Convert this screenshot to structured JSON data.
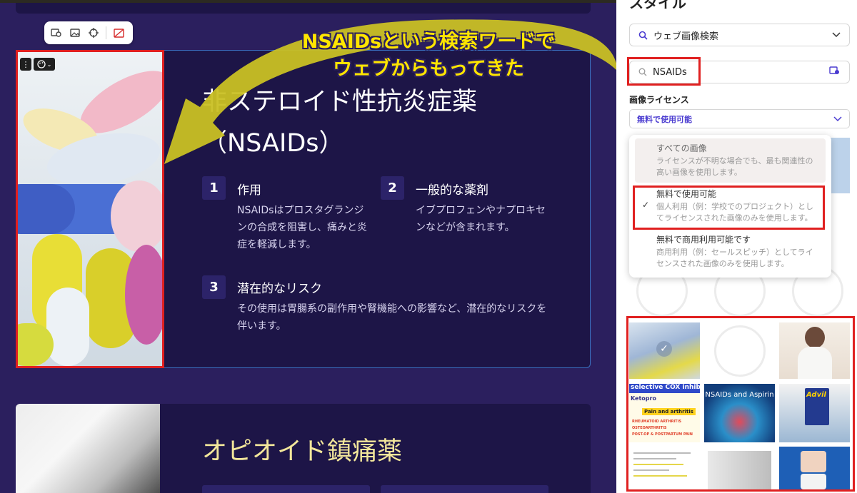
{
  "slide": {
    "heading1_line1": "非ステロイド性抗炎症薬",
    "heading1_line2": "（NSAIDs）",
    "items": [
      {
        "num": "1",
        "title": "作用",
        "body": "NSAIDsはプロスタグランジンの合成を阻害し、痛みと炎症を軽減します。"
      },
      {
        "num": "2",
        "title": "一般的な薬剤",
        "body": "イブプロフェンやナプロキセンなどが含まれます。"
      },
      {
        "num": "3",
        "title": "潜在的なリスク",
        "body": "その使用は胃腸系の副作用や腎機能への影響など、潜在的なリスクを伴います。"
      }
    ],
    "heading2": "オピオイド鎮痛薬"
  },
  "callout": {
    "line1": "NSAIDsという検索ワードで",
    "line2": "ウェブからもってきた"
  },
  "panel": {
    "title": "スタイル",
    "source": "ウェブ画像検索",
    "search_value": "NSAIDs",
    "license_label": "画像ライセンス",
    "license_selected": "無料で使用可能",
    "options": [
      {
        "title": "すべての画像",
        "desc": "ライセンスが不明な場合でも、最も関連性の高い画像を使用します。"
      },
      {
        "title": "無料で使用可能",
        "desc": "個人利用（例：学校でのプロジェクト）としてライセンスされた画像のみを使用します。",
        "checked": true
      },
      {
        "title": "無料で商用利用可能です",
        "desc": "商用利用（例：セールスピッチ）としてライセンスされた画像のみを使用します。"
      }
    ],
    "results": {
      "cox_title": "selective COX inhibit",
      "cox_sub": "Ketopro",
      "cox_l1": "Pain and arthritis",
      "cox_l2": "RHEUMATOID ARTHRITIS",
      "cox_l3": "OSTEOARTHRITIS",
      "cox_l4": "POST-OP & POSTPARTUM PAIN",
      "nsaids_aspirin": "NSAIDs and Aspirin",
      "advil": "Advil"
    }
  },
  "colors": {
    "canvas_bg": "#2b1f5e",
    "card_bg": "#1d1547",
    "accent_yellow": "#ffe500",
    "highlight_red": "#e02020",
    "license_text": "#4a3bd0"
  }
}
